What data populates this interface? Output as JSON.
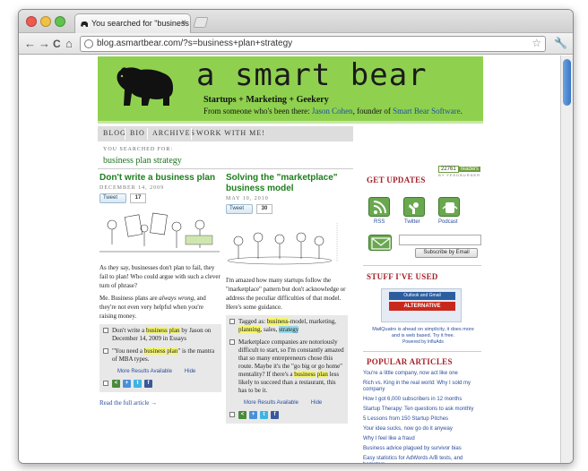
{
  "browser": {
    "tab_title": "You searched for \"business",
    "url": "blog.asmartbear.com/?s=business+plan+strategy",
    "back_glyph": "←",
    "forward_glyph": "→",
    "reload_glyph": "C",
    "home_glyph": "⌂",
    "star_glyph": "☆",
    "wrench_glyph": "🔧",
    "close_glyph": "×"
  },
  "header": {
    "site_title": "a smart bear",
    "tagline": "Startups + Marketing + Geekery",
    "byline_prefix": "From someone who's been there:",
    "author": "Jason Cohen",
    "byline_middle": ", founder of",
    "company": "Smart Bear Software",
    "byline_end": "."
  },
  "nav": {
    "items": [
      "BLOG",
      "BIO",
      "ARCHIVES",
      "WORK WITH ME!"
    ]
  },
  "search": {
    "label": "YOU SEARCHED FOR:",
    "term": "business plan strategy"
  },
  "posts": [
    {
      "title": "Don't write a business plan",
      "date": "DECEMBER 14, 2009",
      "tweet_label": "Tweet",
      "tweet_count": "17",
      "excerpt1": "As they say, businesses don't plan to fail, they fail to plan! Who could argue with such a clever turn of phrase?",
      "excerpt2a": "Me. Business plans are ",
      "excerpt2b": "always wrong",
      "excerpt2c": ", and they're not even very helpful when you're raising money.",
      "rel1_a": "Don't write a ",
      "rel1_h1": "business",
      "rel1_s": " ",
      "rel1_h2": "plan",
      "rel1_b": " by Jason on December 14, 2009 in Essays",
      "rel2_a": "\"You need a ",
      "rel2_h1": "business",
      "rel2_s": " ",
      "rel2_h2": "plan",
      "rel2_b": "\" is the mantra of MBA types.",
      "more": "More Results Available",
      "hide": "Hide",
      "read_more": "Read the full article →"
    },
    {
      "title": "Solving the \"marketplace\" business model",
      "date": "MAY 10, 2010",
      "tweet_label": "Tweet",
      "tweet_count": "30",
      "excerpt1": "I'm amazed how many startups follow the \"marketplace\" pattern but don't acknowledge or address the peculiar difficulties of that model. Here's some guidance.",
      "tags_a": "Tagged as: ",
      "tags_h1": "business",
      "tags_b": "-model, marketing, ",
      "tags_h2": "planning",
      "tags_c": ", sales, ",
      "tags_h3": "strategy",
      "rel2_a": "Marketplace companies are notoriously difficult to start, so I'm constantly amazed that so many entrepreneurs chose this route. Maybe it's the \"go big or go home\" mentality? If there's a ",
      "rel2_h1": "business",
      "rel2_s": " ",
      "rel2_h2": "plan",
      "rel2_b": " less likely to succeed than a restaurant, this has to be it.",
      "more": "More Results Available",
      "hide": "Hide"
    }
  ],
  "sidebar": {
    "updates_heading": "GET UPDATES",
    "readers_count": "22761",
    "readers_label": "readers",
    "feedburner": "BY FEEDBURNER",
    "rss_label": "RSS",
    "twitter_label": "Twitter",
    "podcast_label": "Podcast",
    "subscribe_button": "Subscribe by Email",
    "stuff_heading": "STUFF I'VE USED",
    "ad_line1": "Outlook and Gmail",
    "ad_line2": "ALTERNATIVE",
    "ad_text": "MailQuatro is ahead on simplicity, it does more and is web based. Try it free.",
    "ad_by": "Powered by InfluAds",
    "popular_heading": "POPULAR ARTICLES",
    "popular": [
      "You're a little company, now act like one",
      "Rich vs. King in the real world: Why I sold my company",
      "How I got 6,000 subscribers in 12 months",
      "Startup Therapy: Ten questions to ask monthly",
      "5 Lessons from 150 Startup Pitches",
      "Your idea sucks, now go do it anyway",
      "Why I feel like a fraud",
      "Business advice plagued by survivor bias",
      "Easy statistics for AdWords A/B tests, and hamsters"
    ]
  },
  "colors": {
    "header_green": "#8fd14f",
    "title_green": "#1e7d1e",
    "sidebar_red": "#a5212a",
    "link_blue": "#2a4d9b",
    "highlight_yellow": "#f4f46e",
    "highlight_blue": "#9ad6e8"
  }
}
